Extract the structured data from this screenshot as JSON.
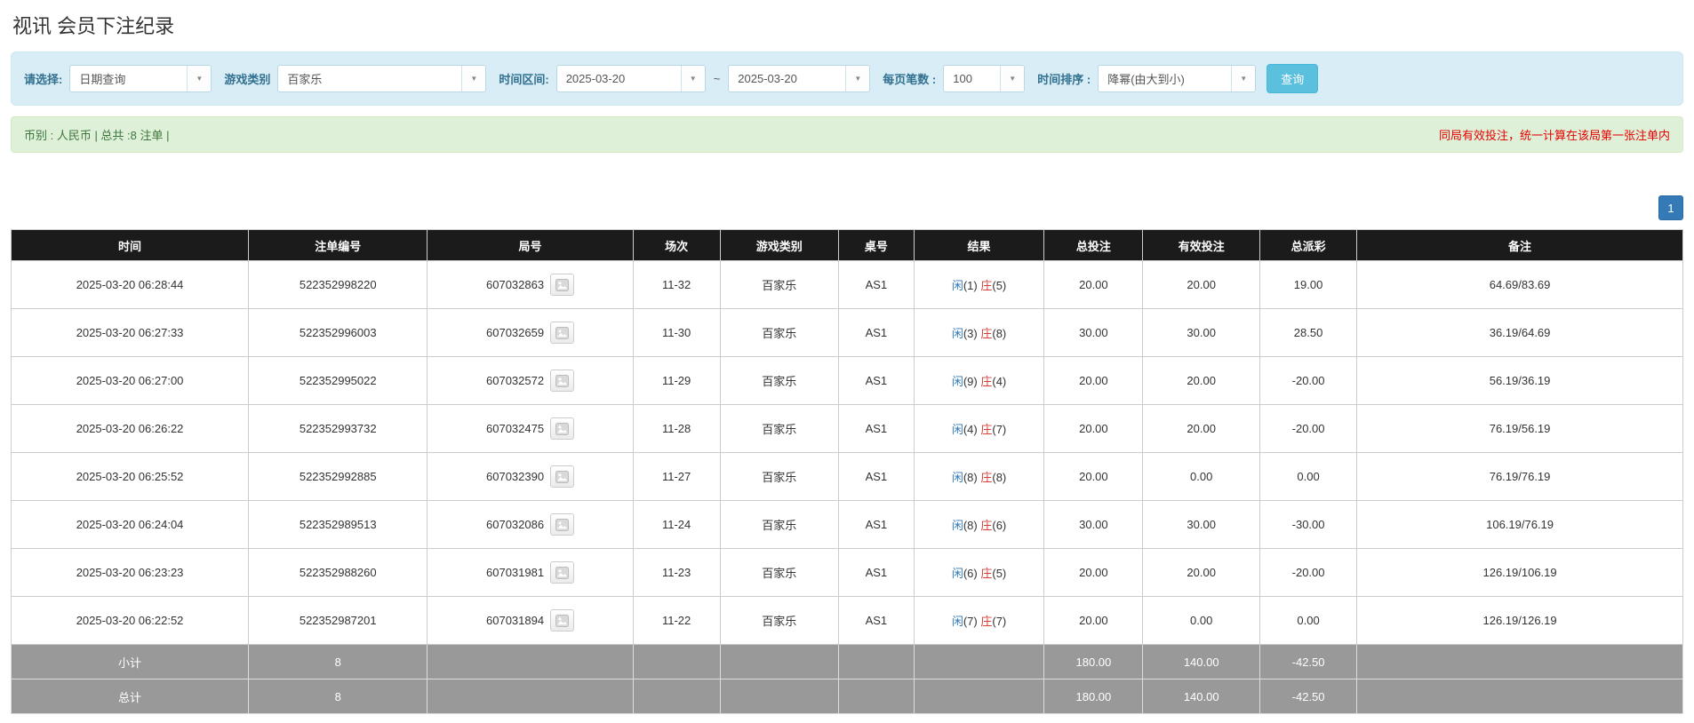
{
  "page": {
    "title": "视讯 会员下注纪录"
  },
  "colors": {
    "accent-blue": "#337ab7",
    "label-blue": "#31708f",
    "search-cyan": "#5bc0de",
    "alert-green-bg": "#dff0d8",
    "alert-green-text": "#3c763d",
    "warn-red": "#e60000",
    "banker-red": "#d43f3a",
    "header-black": "#1b1b1b",
    "footer-gray": "#999999"
  },
  "filters": {
    "select_label": "请选择:",
    "select_value": "日期查询",
    "game_type_label": "游戏类别",
    "game_type_value": "百家乐",
    "time_range_label": "时间区间:",
    "date_from": "2025-03-20",
    "tilde": "~",
    "date_to": "2025-03-20",
    "page_size_label": "每页笔数 :",
    "page_size_value": "100",
    "sort_label": "时间排序 :",
    "sort_value": "降幂(由大到小)",
    "search_button": "查询",
    "dropdown_arrow": "▼"
  },
  "summary": {
    "left": "币别 : 人民币 | 总共 :8 注单 |",
    "right_note": "同局有效投注，统一计算在该局第一张注单内"
  },
  "pagination": {
    "current": "1"
  },
  "table": {
    "columns": [
      "时间",
      "注单编号",
      "局号",
      "场次",
      "游戏类别",
      "桌号",
      "结果",
      "总投注",
      "有效投注",
      "总派彩",
      "备注"
    ],
    "rows": [
      {
        "time": "2025-03-20 06:28:44",
        "bet_id": "522352998220",
        "round_id": "607032863",
        "session": "11-32",
        "game_type": "百家乐",
        "table_no": "AS1",
        "player_label": "闲",
        "player_score": "(1)",
        "banker_label": "庄",
        "banker_score": "(5)",
        "total_bet": "20.00",
        "valid_bet": "20.00",
        "payout": "19.00",
        "note": "64.69/83.69"
      },
      {
        "time": "2025-03-20 06:27:33",
        "bet_id": "522352996003",
        "round_id": "607032659",
        "session": "11-30",
        "game_type": "百家乐",
        "table_no": "AS1",
        "player_label": "闲",
        "player_score": "(3)",
        "banker_label": "庄",
        "banker_score": "(8)",
        "total_bet": "30.00",
        "valid_bet": "30.00",
        "payout": "28.50",
        "note": "36.19/64.69"
      },
      {
        "time": "2025-03-20 06:27:00",
        "bet_id": "522352995022",
        "round_id": "607032572",
        "session": "11-29",
        "game_type": "百家乐",
        "table_no": "AS1",
        "player_label": "闲",
        "player_score": "(9)",
        "banker_label": "庄",
        "banker_score": "(4)",
        "total_bet": "20.00",
        "valid_bet": "20.00",
        "payout": "-20.00",
        "note": "56.19/36.19"
      },
      {
        "time": "2025-03-20 06:26:22",
        "bet_id": "522352993732",
        "round_id": "607032475",
        "session": "11-28",
        "game_type": "百家乐",
        "table_no": "AS1",
        "player_label": "闲",
        "player_score": "(4)",
        "banker_label": "庄",
        "banker_score": "(7)",
        "total_bet": "20.00",
        "valid_bet": "20.00",
        "payout": "-20.00",
        "note": "76.19/56.19"
      },
      {
        "time": "2025-03-20 06:25:52",
        "bet_id": "522352992885",
        "round_id": "607032390",
        "session": "11-27",
        "game_type": "百家乐",
        "table_no": "AS1",
        "player_label": "闲",
        "player_score": "(8)",
        "banker_label": "庄",
        "banker_score": "(8)",
        "total_bet": "20.00",
        "valid_bet": "0.00",
        "payout": "0.00",
        "note": "76.19/76.19"
      },
      {
        "time": "2025-03-20 06:24:04",
        "bet_id": "522352989513",
        "round_id": "607032086",
        "session": "11-24",
        "game_type": "百家乐",
        "table_no": "AS1",
        "player_label": "闲",
        "player_score": "(8)",
        "banker_label": "庄",
        "banker_score": "(6)",
        "total_bet": "30.00",
        "valid_bet": "30.00",
        "payout": "-30.00",
        "note": "106.19/76.19"
      },
      {
        "time": "2025-03-20 06:23:23",
        "bet_id": "522352988260",
        "round_id": "607031981",
        "session": "11-23",
        "game_type": "百家乐",
        "table_no": "AS1",
        "player_label": "闲",
        "player_score": "(6)",
        "banker_label": "庄",
        "banker_score": "(5)",
        "total_bet": "20.00",
        "valid_bet": "20.00",
        "payout": "-20.00",
        "note": "126.19/106.19"
      },
      {
        "time": "2025-03-20 06:22:52",
        "bet_id": "522352987201",
        "round_id": "607031894",
        "session": "11-22",
        "game_type": "百家乐",
        "table_no": "AS1",
        "player_label": "闲",
        "player_score": "(7)",
        "banker_label": "庄",
        "banker_score": "(7)",
        "total_bet": "20.00",
        "valid_bet": "0.00",
        "payout": "0.00",
        "note": "126.19/126.19"
      }
    ],
    "footer": [
      {
        "label": "小计",
        "count": "8",
        "round": "",
        "session": "",
        "game_type": "",
        "table_no": "",
        "result": "",
        "total_bet": "180.00",
        "valid_bet": "140.00",
        "payout": "-42.50",
        "note": ""
      },
      {
        "label": "总计",
        "count": "8",
        "round": "",
        "session": "",
        "game_type": "",
        "table_no": "",
        "result": "",
        "total_bet": "180.00",
        "valid_bet": "140.00",
        "payout": "-42.50",
        "note": ""
      }
    ]
  }
}
